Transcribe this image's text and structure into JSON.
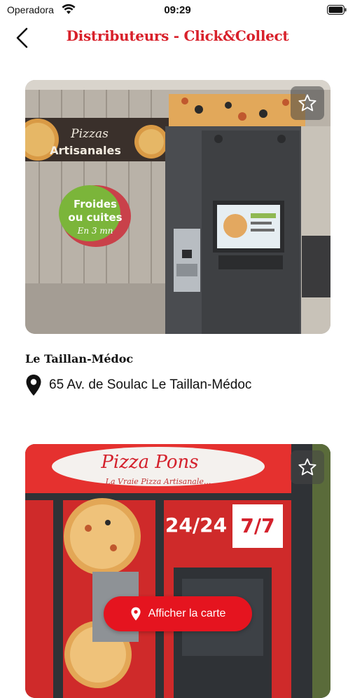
{
  "status_bar": {
    "carrier": "Operadora",
    "time": "09:29"
  },
  "header": {
    "title": "Distributeurs - Click&Collect"
  },
  "vendors": [
    {
      "name": "Le Taillan-Médoc",
      "address": "65 Av. de Soulac Le Taillan-Médoc",
      "photo_texts": {
        "banner_line1": "Pizzas",
        "banner_line2": "Artisanales",
        "badge_line1": "Froides",
        "badge_line2": "ou cuites",
        "badge_line3": "En 3 mn"
      }
    },
    {
      "photo_texts": {
        "brand": "Pizza Pons",
        "tagline": "La Vraie Pizza Artisanale...",
        "hours": "24/24",
        "days": "7/7"
      }
    }
  ],
  "map_button": {
    "label": "Afficher la carte"
  },
  "colors": {
    "accent": "#d8202a",
    "button": "#e5141f"
  },
  "icons": {
    "back": "chevron-left-icon",
    "favorite": "star-outline-icon",
    "location": "location-pin-icon"
  }
}
